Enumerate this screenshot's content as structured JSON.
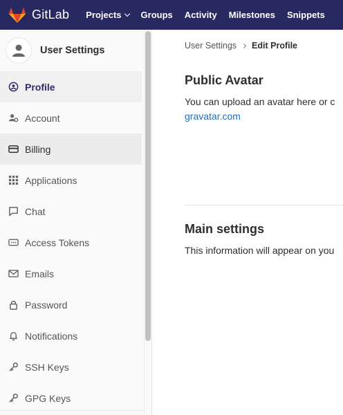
{
  "navbar": {
    "brand": "GitLab",
    "links": [
      "Projects",
      "Groups",
      "Activity",
      "Milestones",
      "Snippets"
    ],
    "colors": {
      "background": "#292961",
      "logo": "#fc6d26"
    }
  },
  "sidebar": {
    "title": "User Settings",
    "items": [
      {
        "label": "Profile",
        "icon": "profile-icon"
      },
      {
        "label": "Account",
        "icon": "account-icon"
      },
      {
        "label": "Billing",
        "icon": "credit-card-icon"
      },
      {
        "label": "Applications",
        "icon": "applications-icon"
      },
      {
        "label": "Chat",
        "icon": "chat-icon"
      },
      {
        "label": "Access Tokens",
        "icon": "token-icon"
      },
      {
        "label": "Emails",
        "icon": "envelope-icon"
      },
      {
        "label": "Password",
        "icon": "lock-icon"
      },
      {
        "label": "Notifications",
        "icon": "bell-icon"
      },
      {
        "label": "SSH Keys",
        "icon": "key-icon"
      },
      {
        "label": "GPG Keys",
        "icon": "key-icon"
      }
    ]
  },
  "breadcrumb": {
    "parent": "User Settings",
    "current": "Edit Profile"
  },
  "public_avatar": {
    "title": "Public Avatar",
    "text": "You can upload an avatar here or c",
    "link": "gravatar.com"
  },
  "main_settings": {
    "title": "Main settings",
    "text": "This information will appear on you"
  }
}
